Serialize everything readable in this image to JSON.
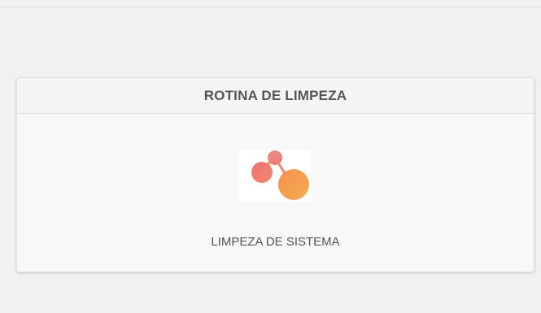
{
  "panel": {
    "title": "ROTINA DE LIMPEZA"
  },
  "task": {
    "icon": "molecule-logo-icon",
    "label": "LIMPEZA DE SISTEMA"
  },
  "colors": {
    "logo_pink": "#ee7476",
    "logo_orange": "#f4a24c",
    "connector": "#e68a69"
  }
}
